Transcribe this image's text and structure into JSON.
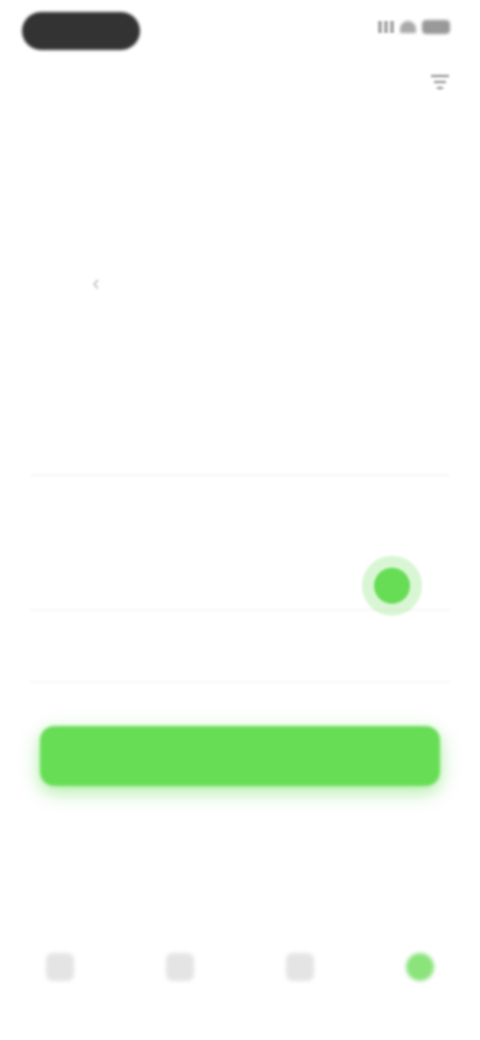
{
  "status_bar": {
    "time": "",
    "icons": [
      "signal-icon",
      "wifi-icon",
      "battery-icon"
    ]
  },
  "header": {
    "title": "",
    "action_icon": "filter-icon"
  },
  "tabs": [
    {
      "label": ""
    },
    {
      "label": ""
    },
    {
      "label": ""
    }
  ],
  "section": {
    "title": "",
    "link": ""
  },
  "date_selector": {
    "range": "",
    "prev_icon": "chevron-left-icon"
  },
  "stats": [
    {
      "value": "",
      "label": ""
    },
    {
      "value": "",
      "label": ""
    },
    {
      "value": "",
      "label": ""
    }
  ],
  "chart_data": {
    "type": "scatter",
    "series": [
      {
        "values": [
          0.3
        ]
      }
    ],
    "y_tick_labels": [
      "",
      "",
      ""
    ],
    "x_tick_labels": [
      ""
    ],
    "accent_color": "#66dd55"
  },
  "primary_button": {
    "label": ""
  },
  "secondary_link": {
    "label": ""
  },
  "bottom_nav": [
    {
      "icon": "home-icon",
      "label": ""
    },
    {
      "icon": "list-icon",
      "label": ""
    },
    {
      "icon": "chart-icon",
      "label": ""
    },
    {
      "icon": "profile-icon",
      "label": "",
      "active": true
    }
  ],
  "colors": {
    "accent": "#66dd55",
    "text_dark": "#333333",
    "text_muted": "#bbbbbb"
  }
}
